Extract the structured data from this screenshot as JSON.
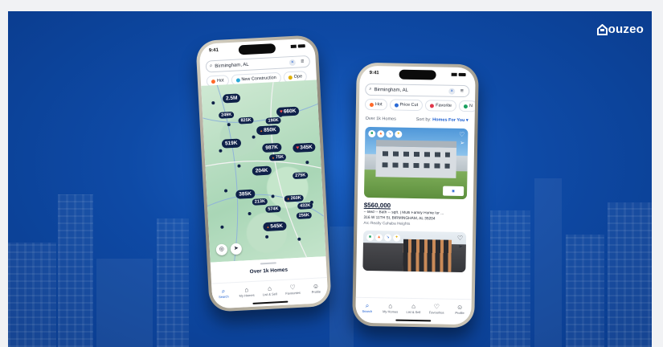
{
  "brand": {
    "name": "ouzeo"
  },
  "map_phone": {
    "status_time": "9:41",
    "search_value": "Birmingham, AL",
    "chips": [
      "Hot",
      "New Construction",
      "Ope"
    ],
    "pins": [
      "2.5M",
      "249K",
      "825K",
      "660K",
      "190K",
      "850K",
      "519K",
      "987K",
      "345K",
      "75K",
      "204K",
      "275K",
      "385K",
      "213K",
      "260K",
      "574K",
      "432K",
      "256K",
      "545K"
    ],
    "sheet_title": "Over 1k Homes",
    "tabs": [
      "Search",
      "My Homes",
      "List & Sell",
      "Favourites",
      "Profile"
    ]
  },
  "list_phone": {
    "status_time": "9:41",
    "search_value": "Birmingham, AL",
    "chips": [
      "Hot",
      "Price Cut",
      "Favorite",
      "N"
    ],
    "results_label": "Over 1k Homes",
    "sort_label": "Sort by:",
    "sort_value": "Homes For You",
    "listing": {
      "price": "$560,000",
      "specs": "-- Bed  -- Bath  -- sqft. | Multi Family Home for ...",
      "address": "316 W 11TH St, BIRMINGHAM, AL 35204",
      "broker": "Arc Realty Cahaba Heights"
    },
    "tabs": [
      "Search",
      "My Homes",
      "List & Sell",
      "Favourites",
      "Profile"
    ]
  },
  "colors": {
    "brand_blue": "#0e4aa6",
    "accent": "#1d5fd1",
    "pin": "#0f2149"
  }
}
